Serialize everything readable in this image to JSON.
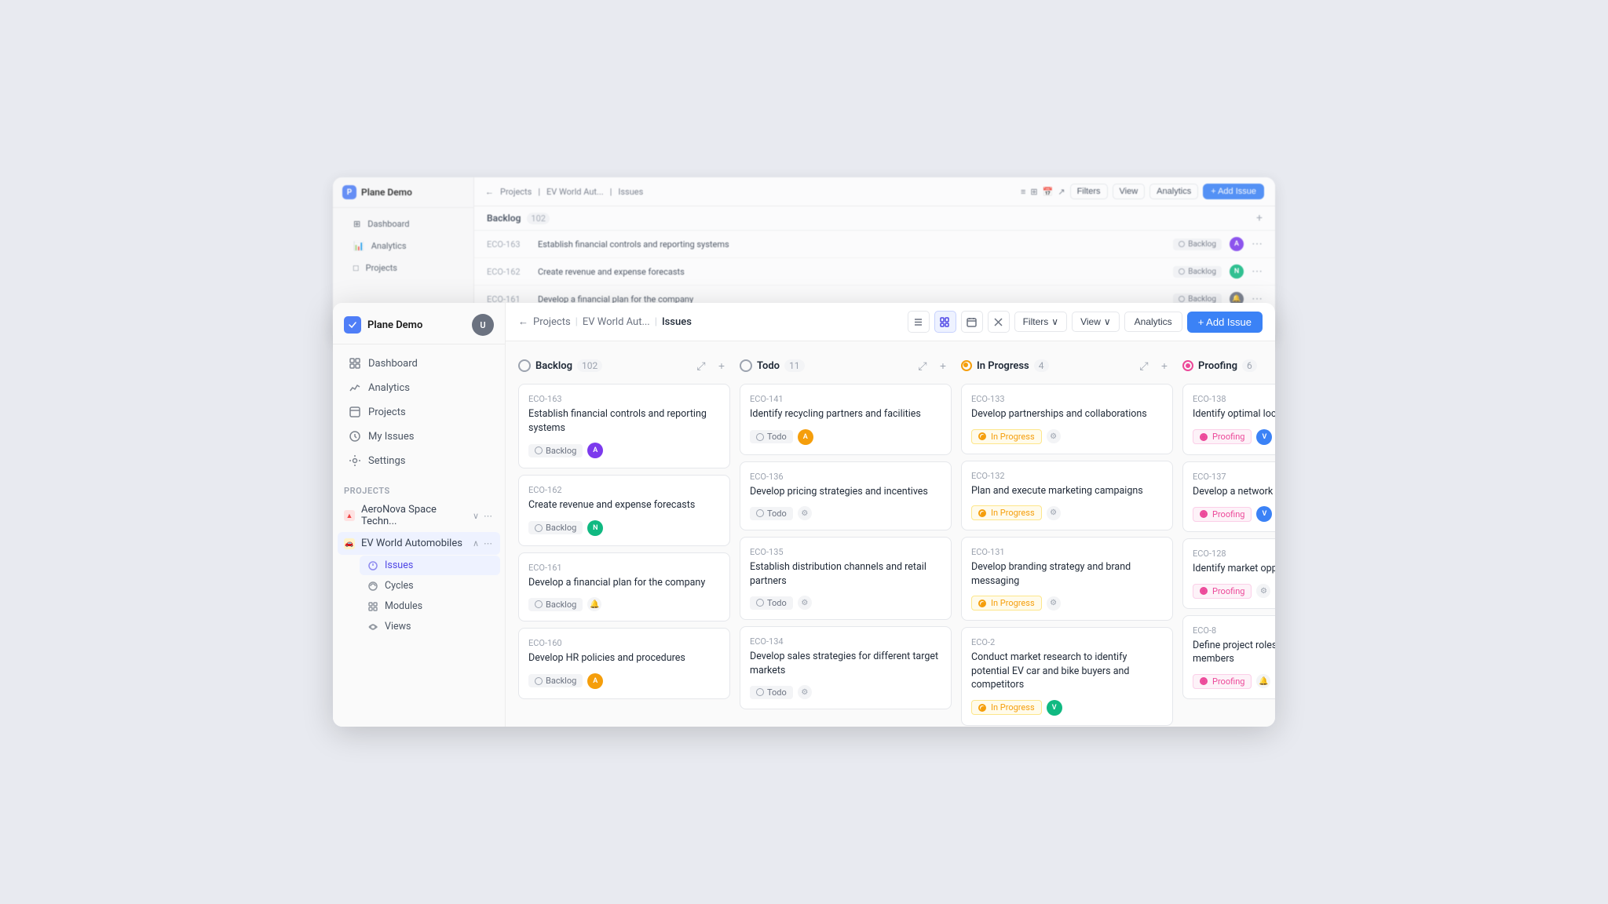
{
  "app": {
    "name": "Plane Demo",
    "logo_label": "P"
  },
  "nav": {
    "items": [
      {
        "id": "dashboard",
        "label": "Dashboard"
      },
      {
        "id": "analytics",
        "label": "Analytics"
      },
      {
        "id": "projects",
        "label": "Projects"
      },
      {
        "id": "my-issues",
        "label": "My Issues"
      },
      {
        "id": "settings",
        "label": "Settings"
      }
    ]
  },
  "projects_section_label": "Projects",
  "projects": [
    {
      "id": "aeronova",
      "label": "AeroNova Space Techn...",
      "color": "red"
    },
    {
      "id": "ev-world",
      "label": "EV World Automobiles",
      "color": "orange"
    }
  ],
  "sub_nav": [
    {
      "id": "issues",
      "label": "Issues",
      "active": true
    },
    {
      "id": "cycles",
      "label": "Cycles"
    },
    {
      "id": "modules",
      "label": "Modules"
    },
    {
      "id": "views",
      "label": "Views"
    }
  ],
  "breadcrumb": {
    "projects": "Projects",
    "project": "EV World Aut...",
    "current": "Issues"
  },
  "toolbar": {
    "filters_label": "Filters",
    "view_label": "View",
    "analytics_label": "Analytics",
    "add_issue_label": "+ Add Issue"
  },
  "columns": [
    {
      "id": "backlog",
      "title": "Backlog",
      "count": 102,
      "status": "backlog",
      "issues": [
        {
          "id": "ECO-163",
          "title": "Establish financial controls and reporting systems",
          "status": "Backlog",
          "avatar_label": "A",
          "avatar_color": "purple"
        },
        {
          "id": "ECO-162",
          "title": "Create revenue and expense forecasts",
          "status": "Backlog",
          "avatar_label": "N",
          "avatar_color": "green"
        },
        {
          "id": "ECO-161",
          "title": "Develop a financial plan for the company",
          "status": "Backlog",
          "avatar_label": "🔔",
          "avatar_color": "gray"
        },
        {
          "id": "ECO-160",
          "title": "Develop HR policies and procedures",
          "status": "Backlog",
          "avatar_label": "A",
          "avatar_color": "orange"
        }
      ]
    },
    {
      "id": "todo",
      "title": "Todo",
      "count": 11,
      "status": "todo",
      "issues": [
        {
          "id": "ECO-141",
          "title": "Identify recycling partners and facilities",
          "status": "Todo",
          "avatar_label": "A",
          "avatar_color": "orange",
          "has_gear": false
        },
        {
          "id": "ECO-136",
          "title": "Develop pricing strategies and incentives",
          "status": "Todo",
          "avatar_label": "⚙",
          "avatar_color": "gray",
          "has_gear": true
        },
        {
          "id": "ECO-135",
          "title": "Establish distribution channels and retail partners",
          "status": "Todo",
          "avatar_label": "⚙",
          "avatar_color": "gray",
          "has_gear": true
        },
        {
          "id": "ECO-134",
          "title": "Develop sales strategies for different target markets",
          "status": "Todo",
          "avatar_label": "⚙",
          "avatar_color": "gray",
          "has_gear": true
        }
      ]
    },
    {
      "id": "in-progress",
      "title": "In Progress",
      "count": 4,
      "status": "in-progress",
      "issues": [
        {
          "id": "ECO-133",
          "title": "Develop partnerships and collaborations",
          "status": "In Progress",
          "avatar_label": "⚙",
          "avatar_color": "gray",
          "has_gear": true
        },
        {
          "id": "ECO-132",
          "title": "Plan and execute marketing campaigns",
          "status": "In Progress",
          "avatar_label": "⚙",
          "avatar_color": "gray",
          "has_gear": true
        },
        {
          "id": "ECO-131",
          "title": "Develop branding strategy and brand messaging",
          "status": "In Progress",
          "avatar_label": "⚙",
          "avatar_color": "gray",
          "has_gear": true
        },
        {
          "id": "ECO-2",
          "title": "Conduct market research to identify potential EV car and bike buyers and competitors",
          "status": "In Progress",
          "avatar_label": "V",
          "avatar_color": "green",
          "has_gear": false
        }
      ]
    },
    {
      "id": "proofing",
      "title": "Proofing",
      "count": 6,
      "status": "proofing",
      "issues": [
        {
          "id": "ECO-138",
          "title": "Identify optimal locations for",
          "status": "Proofing",
          "avatar_label": "V",
          "avatar_color": "blue"
        },
        {
          "id": "ECO-137",
          "title": "Develop a network of chargi",
          "status": "Proofing",
          "avatar_label": "V",
          "avatar_color": "blue"
        },
        {
          "id": "ECO-128",
          "title": "Identify market opportunitie",
          "status": "Proofing",
          "avatar_label": "⚙",
          "avatar_color": "gray"
        },
        {
          "id": "ECO-8",
          "title": "Define project roles and resp asks to team members",
          "status": "Proofing",
          "avatar_label": "🔔",
          "avatar_color": "gray"
        }
      ]
    }
  ],
  "bg_issues": [
    {
      "id": "ECO-163",
      "title": "Establish financial controls and reporting systems",
      "status": "Backlog"
    },
    {
      "id": "ECO-162",
      "title": "Create revenue and expense forecasts",
      "status": "Backlog"
    },
    {
      "id": "ECO-161",
      "title": "Develop a financial plan for the company",
      "status": "Backlog"
    },
    {
      "id": "ECO-160",
      "title": "Develop HR policies and procedures",
      "status": "Backlog"
    }
  ]
}
